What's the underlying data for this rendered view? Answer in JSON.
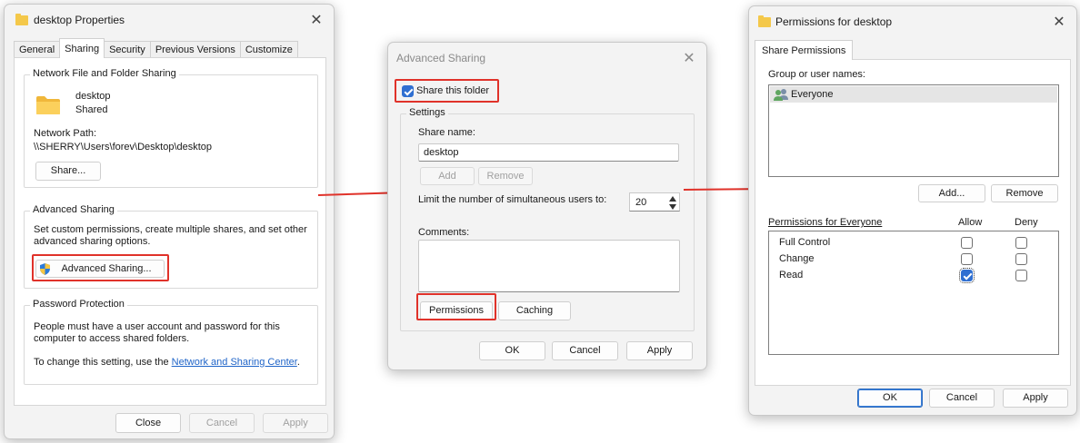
{
  "props": {
    "title": "desktop Properties",
    "tabs": [
      "General",
      "Sharing",
      "Security",
      "Previous Versions",
      "Customize"
    ],
    "net_group_title": "Network File and Folder Sharing",
    "folder_name": "desktop",
    "folder_status": "Shared",
    "network_path_label": "Network Path:",
    "network_path_value": "\\\\SHERRY\\Users\\forev\\Desktop\\desktop",
    "share_button": "Share...",
    "adv_group_title": "Advanced Sharing",
    "adv_desc_1": "Set custom permissions, create multiple shares, and set other",
    "adv_desc_2": "advanced sharing options.",
    "adv_button": "Advanced Sharing...",
    "pwd_group_title": "Password Protection",
    "pwd_desc_1": "People must have a user account and password for this",
    "pwd_desc_2": "computer to access shared folders.",
    "pwd_change_prefix": "To change this setting, use the ",
    "pwd_link": "Network and Sharing Center",
    "pwd_change_suffix": ".",
    "close_button": "Close",
    "cancel_button": "Cancel",
    "apply_button": "Apply"
  },
  "adv": {
    "title": "Advanced Sharing",
    "share_folder_label": "Share this folder",
    "share_folder_checked": true,
    "settings_title": "Settings",
    "share_name_label": "Share name:",
    "share_name_value": "desktop",
    "add_button": "Add",
    "remove_button": "Remove",
    "limit_label": "Limit the number of simultaneous users to:",
    "limit_value": "20",
    "comments_label": "Comments:",
    "permissions_button": "Permissions",
    "caching_button": "Caching",
    "ok_button": "OK",
    "cancel_button": "Cancel",
    "apply_button": "Apply"
  },
  "perm": {
    "title": "Permissions for desktop",
    "tab": "Share Permissions",
    "group_label": "Group or user names:",
    "users": [
      "Everyone"
    ],
    "add_button": "Add...",
    "remove_button": "Remove",
    "perm_for_label": "Permissions for Everyone",
    "allow_header": "Allow",
    "deny_header": "Deny",
    "rows": [
      {
        "name": "Full Control",
        "allow": false,
        "deny": false
      },
      {
        "name": "Change",
        "allow": false,
        "deny": false
      },
      {
        "name": "Read",
        "allow": true,
        "deny": false
      }
    ],
    "ok_button": "OK",
    "cancel_button": "Cancel",
    "apply_button": "Apply"
  },
  "colors": {
    "highlight": "#e0322a",
    "accent": "#2f6fd1",
    "link": "#1f64c8"
  }
}
